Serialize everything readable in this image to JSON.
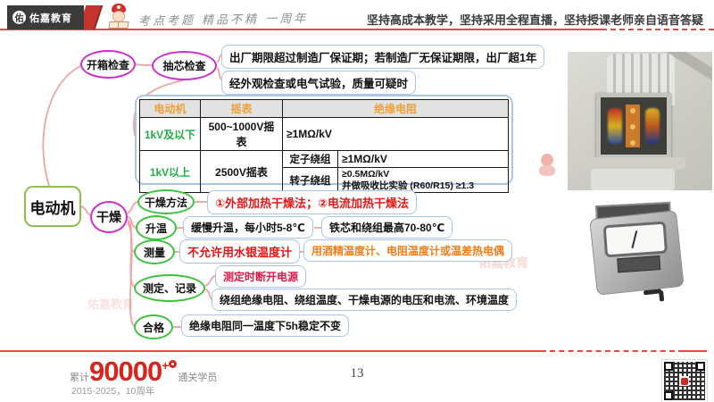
{
  "header": {
    "logo": "佑嘉教育",
    "logo_badge": "佑",
    "slogan": "考点考题 精品不精 一周年",
    "tagline": "坚持高成本教学，坚持采用全程直播，坚持授课老师亲自语音答疑"
  },
  "mindmap": {
    "root": "电动机",
    "unboxing": "开箱检查",
    "core_check": "抽芯检查",
    "core_note1": "出厂期限超过制造厂保证期；若制造厂无保证期限，出厂超1年",
    "core_note2": "经外观检查或电气试验，质量可疑时",
    "drying": "干燥",
    "method_label": "干燥方法",
    "method_note": "①外部加热干燥法；②电流加热干燥法",
    "heatup_label": "升温",
    "heatup_note1": "缓慢升温，每小时5-8℃",
    "heatup_note2": "铁芯和绕组最高70-80℃",
    "measure_label": "测量",
    "measure_note1": "不允许用水银温度计",
    "measure_note2": "用酒精温度计、电阻温度计或温差热电偶",
    "record_label": "测定、记录",
    "record_note1": "测定时断开电源",
    "record_note2": "绕组绝缘电阻、绕组温度、干燥电源的电压和电流、环境温度",
    "pass_label": "合格",
    "pass_note": "绝缘电阻同一温度下5h稳定不变"
  },
  "table": {
    "header_motor": "电动机",
    "header_megger": "摇表",
    "header_resistance": "绝缘电阻",
    "row1_motor": "1kV及以下",
    "row1_megger": "500~1000V摇表",
    "row1_value": "≥1MΩ/kV",
    "row2_motor": "1kV以上",
    "row2_megger": "2500V摇表",
    "row2_stator_label": "定子绕组",
    "row2_stator_value": "≥1MΩ/kV",
    "row2_rotor_label": "转子绕组",
    "row2_rotor_value1": "≥0.5MΩ/kV",
    "row2_rotor_value2": "并做吸收比实验 (R60/R15) ≥1.3"
  },
  "footer": {
    "stat_prefix": "累计",
    "stat_number": "90000",
    "stat_plus": "+",
    "stat_suffix": "通关学员",
    "anniversary": "2015-2025，10周年",
    "page_number": "13"
  },
  "watermark": {
    "text": "佑嘉教育"
  },
  "icons": {
    "logo_badge": "brand-circle",
    "mascot": "chef-mascot-reading-book",
    "qr": "qr-code",
    "photo_top": "motor-terminal-box-photo",
    "photo_bottom": "insulation-megger-photo"
  },
  "colors": {
    "accent_red": "#e14b44",
    "magenta_node": "#cb2fcb",
    "green_node": "#3cc23c",
    "root_border": "#8fbf50",
    "blue_box_border": "#a9c6e8",
    "red_text": "#e51717",
    "orange_text": "#ef7d1a",
    "green_text": "#1fae45",
    "table_header_text": "#f0a039",
    "stat_red": "#d6251f",
    "connector": "#eda0a0"
  }
}
